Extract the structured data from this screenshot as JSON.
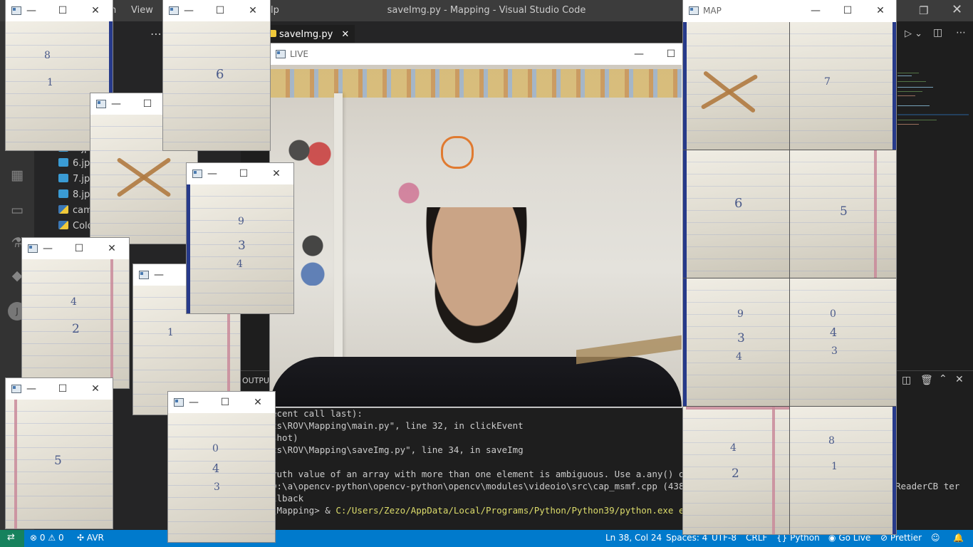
{
  "window": {
    "title": "saveImg.py - Mapping - Visual Studio Code",
    "menu": [
      "on",
      "View",
      "lp"
    ]
  },
  "sidebar": {
    "files": [
      {
        "name": "5.jpg",
        "type": "image"
      },
      {
        "name": "6.jpg",
        "type": "image"
      },
      {
        "name": "7.jpg",
        "type": "image"
      },
      {
        "name": "8.jpg",
        "type": "image"
      },
      {
        "name": "cam",
        "type": "python"
      },
      {
        "name": "Colo",
        "type": "python"
      }
    ],
    "more_icon": "ellipsis-icon"
  },
  "editor": {
    "active_tab": "saveImg.py",
    "panel_tab": "OUTPU"
  },
  "terminal": {
    "lines": [
      "ecent call last):",
      "ts\\ROV\\Mapping\\main.py\", line 32, in clickEvent",
      "shot)",
      "ts\\ROV\\Mapping\\saveImg.py\", line 34, in saveImg",
      ")",
      "ruth value of an array with more than one element is ambiguous. Use a.any() or a.al",
      "D:\\a\\opencv-python\\opencv-python\\opencv\\modules\\videoio\\src\\cap_msmf.cpp (438) `anc",
      "llback"
    ],
    "prompt_prefix": "\\Mapping> & ",
    "prompt_cmd": "C:/Users/Zezo/AppData/Local/Programs/Python/Python39/python.exe e:/Pro",
    "right_fragment": "ReaderCB ter"
  },
  "statusbar": {
    "errors": "0",
    "warnings": "0",
    "board": "AVR",
    "position": "Ln 38, Col 24",
    "spaces": "Spaces: 4",
    "encoding": "UTF-8",
    "eol": "CRLF",
    "language": "Python",
    "live": "Go Live",
    "prettier": "Prettier"
  },
  "cv_windows": {
    "live_title": "LIVE",
    "map_title": "MAP",
    "digits": {
      "w1": [
        "8",
        "1"
      ],
      "w2": [
        "6"
      ],
      "w4": [
        "9",
        "3",
        "4"
      ],
      "w5": [
        "4",
        "2"
      ],
      "w6": [
        "1"
      ],
      "w7": [
        "5"
      ],
      "w8": [
        "0",
        "4",
        "3"
      ],
      "map": [
        "7",
        "6",
        "5",
        "9",
        "3",
        "4",
        "0",
        "4",
        "3",
        "4",
        "2",
        "8",
        "1"
      ]
    }
  },
  "colors": {
    "statusbar": "#007acc",
    "titlebar": "#3c3c3c",
    "editor_bg": "#1e1e1e",
    "sidebar_bg": "#252526"
  }
}
